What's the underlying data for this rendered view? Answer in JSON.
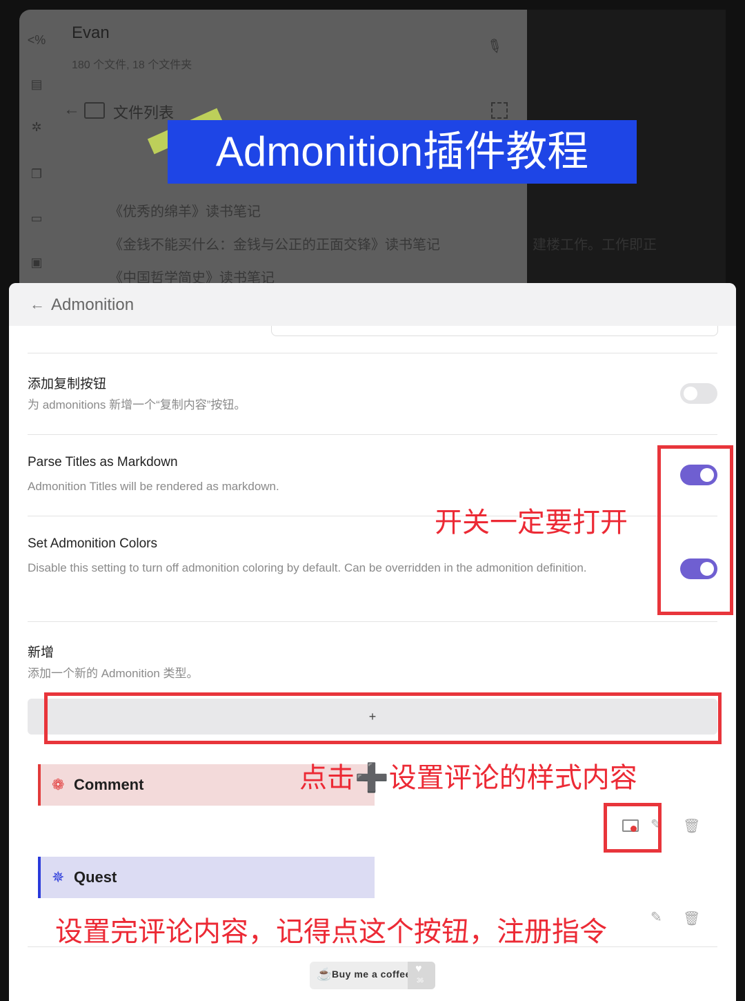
{
  "background": {
    "vault_name": "Evan",
    "vault_stats": "180 个文件, 18 个文件夹",
    "file_list_title": "文件列表",
    "books": [
      "《优秀的绵羊》读书笔记",
      "《金钱不能买什么：金钱与公正的正面交锋》读书笔记",
      "《中国哲学简史》读书笔记"
    ],
    "right_text": "建楼工作。工作即正",
    "banner": "Admonition插件教程"
  },
  "panel": {
    "title": "Admonition",
    "settings": [
      {
        "name": "添加复制按钮",
        "desc": "为 admonitions 新增一个“复制内容”按钮。",
        "enabled": false
      },
      {
        "name": "Parse Titles as Markdown",
        "desc": "Admonition Titles will be rendered as markdown.",
        "enabled": true
      },
      {
        "name": "Set Admonition Colors",
        "desc": "Disable this setting to turn off admonition coloring by default. Can be overridden in the admonition definition.",
        "enabled": true
      }
    ],
    "add": {
      "name": "新增",
      "desc": "添加一个新的 Admonition 类型。",
      "button": "+"
    },
    "admonitions": [
      {
        "label": "Comment",
        "icon": "gear-icon",
        "color": "#e23b3b",
        "bg": "#f3dada"
      },
      {
        "label": "Quest",
        "icon": "asterisk-icon",
        "color": "#2a3adb",
        "bg": "#dcdcf3"
      }
    ],
    "coffee": {
      "label": "Buy me a coffee",
      "count": "36"
    }
  },
  "annotations": {
    "toggles_note": "开关一定要打开",
    "add_note": "点击➕设置评论的样式内容",
    "register_note": "设置完评论内容，记得点这个按钮，注册指令"
  },
  "colors": {
    "accent": "#6f5fd1",
    "annotation": "#ec2a35",
    "banner": "#1e45e6"
  }
}
